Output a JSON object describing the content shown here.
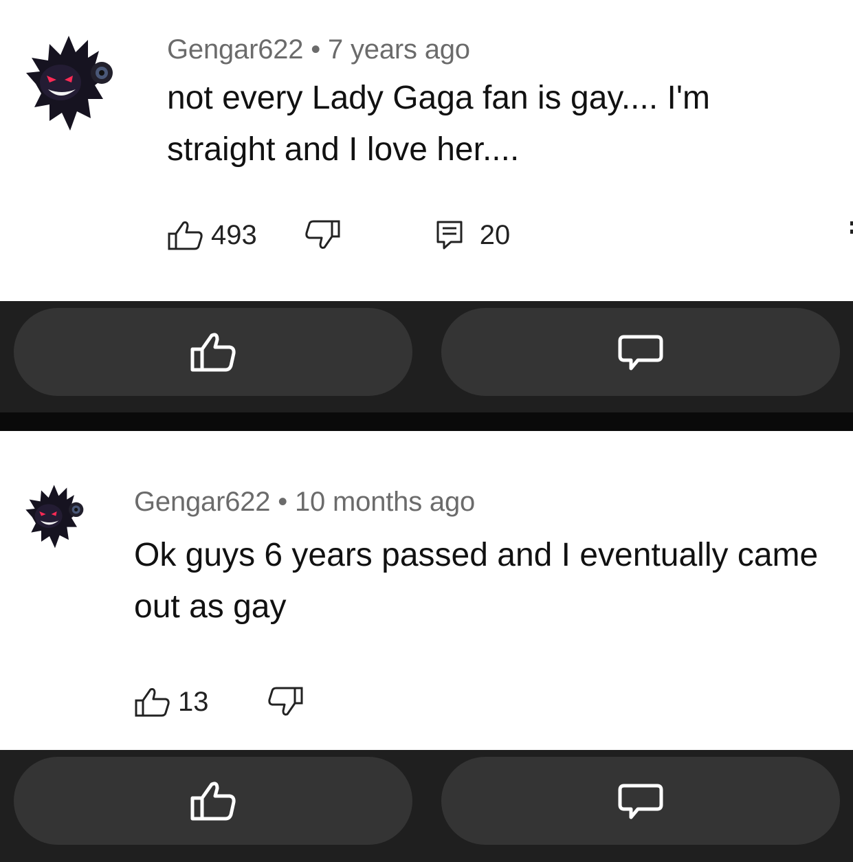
{
  "comments": [
    {
      "author": "Gengar622",
      "separator": "•",
      "time": "7 years ago",
      "text": "not every Lady Gaga fan is gay.... I'm straight and I love her....",
      "likes": "493",
      "replies": "20"
    },
    {
      "author": "Gengar622",
      "separator": "•",
      "time": "10 months ago",
      "text": "Ok guys 6 years passed and I eventually came out as gay",
      "likes": "13"
    }
  ],
  "icons": {
    "like": "thumbs-up-icon",
    "dislike": "thumbs-down-icon",
    "reply": "comment-icon",
    "avatar": "gengar-avatar"
  },
  "colors": {
    "bar_background": "#1f1f1f",
    "pill_background": "#343434",
    "meta_text": "#6b6b6b"
  }
}
